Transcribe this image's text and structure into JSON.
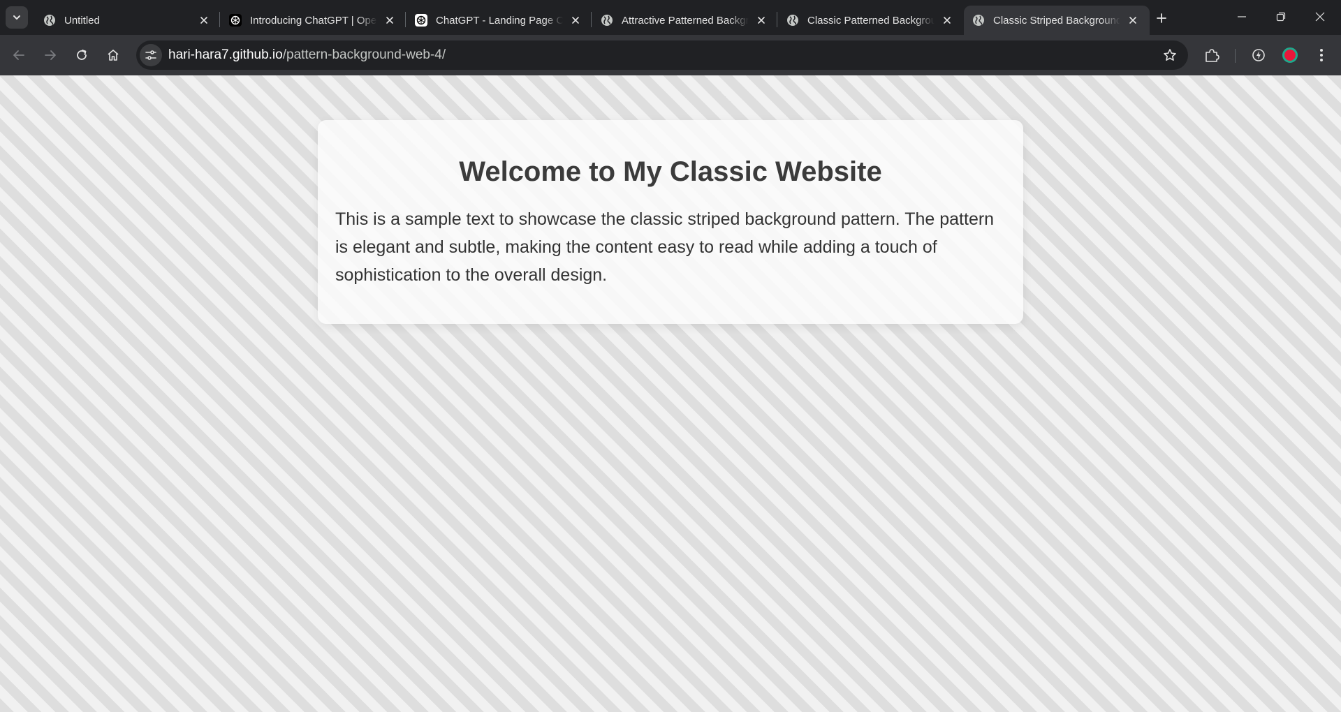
{
  "browser": {
    "tabs": [
      {
        "title": "Untitled",
        "favicon": "globe-icon",
        "active": false
      },
      {
        "title": "Introducing ChatGPT | OpenAI",
        "favicon": "openai-icon",
        "active": false
      },
      {
        "title": "ChatGPT - Landing Page Creation",
        "favicon": "openai-icon",
        "active": false
      },
      {
        "title": "Attractive Patterned Background",
        "favicon": "globe-icon",
        "active": false
      },
      {
        "title": "Classic Patterned Background",
        "favicon": "globe-icon",
        "active": false
      },
      {
        "title": "Classic Striped Background",
        "favicon": "globe-icon",
        "active": true
      }
    ],
    "address_bar": {
      "host": "hari-hara7.github.io",
      "path": "/pattern-background-web-4/"
    },
    "icons": {
      "tab_search": "chevron-down-icon",
      "new_tab": "plus-icon",
      "back": "arrow-left-icon",
      "forward": "arrow-right-icon",
      "reload": "reload-icon",
      "home": "home-icon",
      "site_info": "tune-icon",
      "bookmark": "star-icon",
      "extensions": "puzzle-icon",
      "performance": "speed-icon",
      "profile": "profile-avatar",
      "menu": "more-vertical-icon"
    },
    "colors": {
      "frame": "#202124",
      "toolbar": "#35363a",
      "profile_ring": "#1fa88c",
      "profile_fill": "#e8173a"
    }
  },
  "page": {
    "heading": "Welcome to My Classic Website",
    "paragraph": "This is a sample text to showcase the classic striped background pattern. The pattern is elegant and subtle, making the content easy to read while adding a touch of sophistication to the overall design.",
    "colors": {
      "stripe_dark": "#dedede",
      "stripe_light": "#f1f1f1",
      "card_bg": "#fafafa",
      "heading": "#3b3b3b",
      "text": "#333333"
    }
  }
}
